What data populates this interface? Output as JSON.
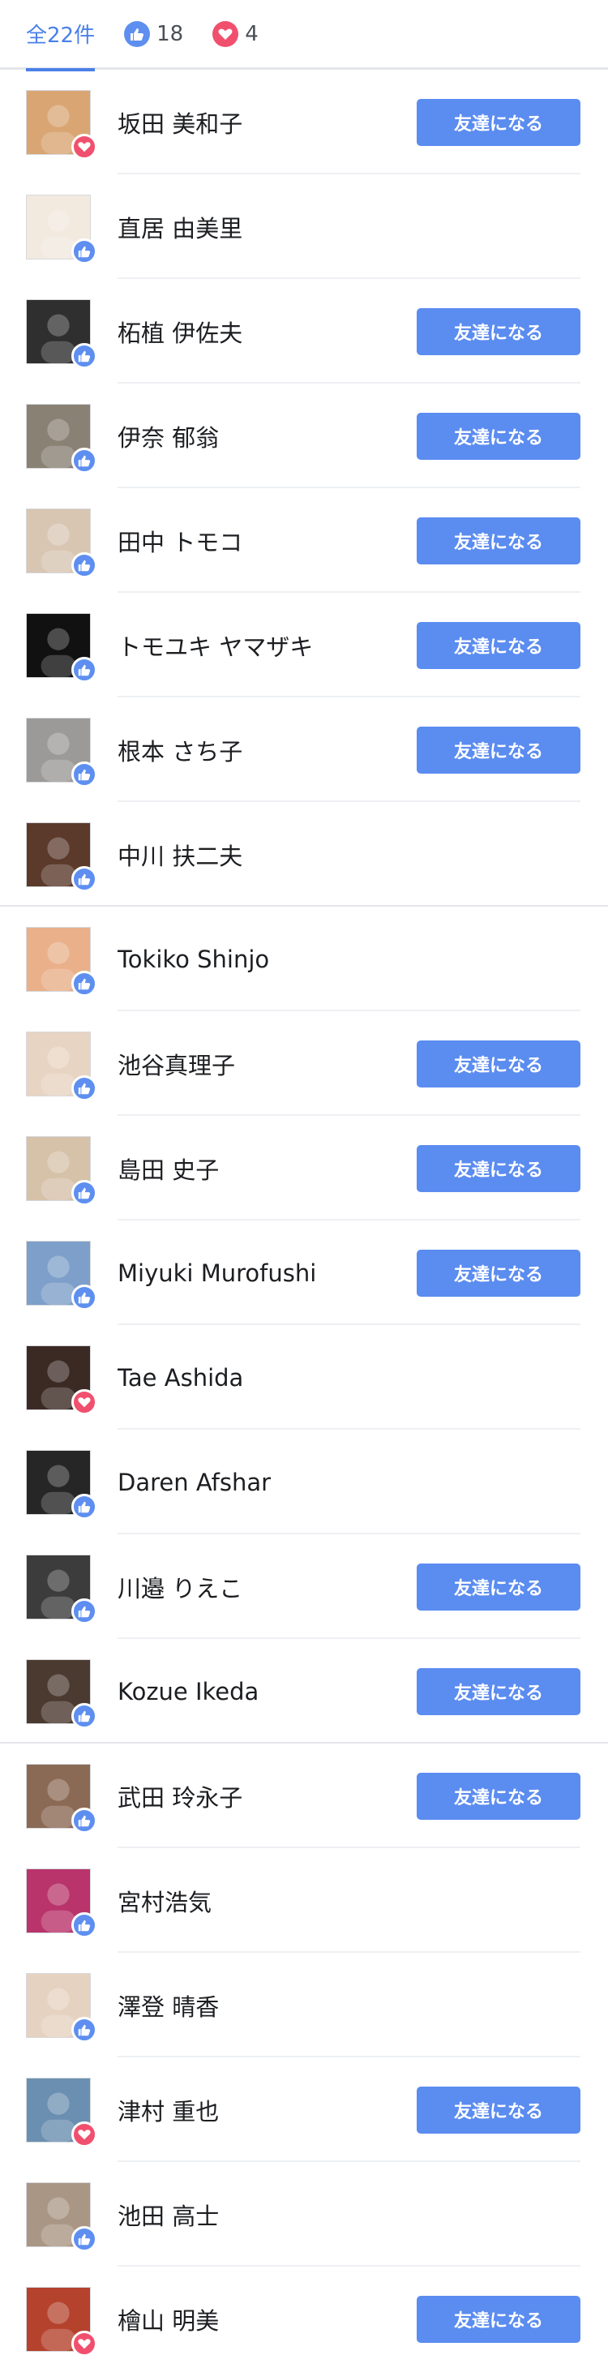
{
  "tabs": {
    "all_label": "全22件",
    "like_count": "18",
    "love_count": "4"
  },
  "add_friend_label": "友達になる",
  "colors": {
    "accent": "#4a80e8",
    "like": "#5e8ff0",
    "love": "#f0506e",
    "button": "#5b8cf0"
  },
  "people": [
    {
      "name": "坂田 美和子",
      "reaction": "love",
      "button": true,
      "avatar": "#d9a673"
    },
    {
      "name": "直居 由美里",
      "reaction": "like",
      "button": false,
      "avatar": "#f2e9df"
    },
    {
      "name": "柘植 伊佐夫",
      "reaction": "like",
      "button": true,
      "avatar": "#2f2f2f"
    },
    {
      "name": "伊奈 郁翁",
      "reaction": "like",
      "button": true,
      "avatar": "#8a8175"
    },
    {
      "name": "田中 トモコ",
      "reaction": "like",
      "button": true,
      "avatar": "#d8c6b3"
    },
    {
      "name": "トモユキ ヤマザキ",
      "reaction": "like",
      "button": true,
      "avatar": "#111111"
    },
    {
      "name": "根本 さち子",
      "reaction": "like",
      "button": true,
      "avatar": "#9c9a98"
    },
    {
      "name": "中川 扶二夫",
      "reaction": "like",
      "button": false,
      "avatar": "#5b3a2c"
    },
    {
      "name": "Tokiko Shinjo",
      "reaction": "like",
      "button": false,
      "avatar": "#e9b08a"
    },
    {
      "name": "池谷真理子",
      "reaction": "like",
      "button": true,
      "avatar": "#e8d4c2"
    },
    {
      "name": "島田 史子",
      "reaction": "like",
      "button": true,
      "avatar": "#d6c1a9"
    },
    {
      "name": "Miyuki Murofushi",
      "reaction": "like",
      "button": true,
      "avatar": "#7d9fc9"
    },
    {
      "name": "Tae Ashida",
      "reaction": "love",
      "button": false,
      "avatar": "#3b2a24"
    },
    {
      "name": "Daren Afshar",
      "reaction": "like",
      "button": false,
      "avatar": "#262626"
    },
    {
      "name": "川邉 りえこ",
      "reaction": "like",
      "button": true,
      "avatar": "#3c3c3c"
    },
    {
      "name": "Kozue Ikeda",
      "reaction": "like",
      "button": true,
      "avatar": "#4b3a30"
    },
    {
      "name": "武田 玲永子",
      "reaction": "like",
      "button": true,
      "avatar": "#8b6a55"
    },
    {
      "name": "宮村浩気",
      "reaction": "like",
      "button": false,
      "avatar": "#b8346a"
    },
    {
      "name": "澤登 晴香",
      "reaction": "like",
      "button": false,
      "avatar": "#e6d2c0"
    },
    {
      "name": "津村 重也",
      "reaction": "love",
      "button": true,
      "avatar": "#6b8fb0"
    },
    {
      "name": "池田 高士",
      "reaction": "like",
      "button": false,
      "avatar": "#a99684"
    },
    {
      "name": "檜山 明美",
      "reaction": "love",
      "button": true,
      "avatar": "#b4422c"
    }
  ]
}
